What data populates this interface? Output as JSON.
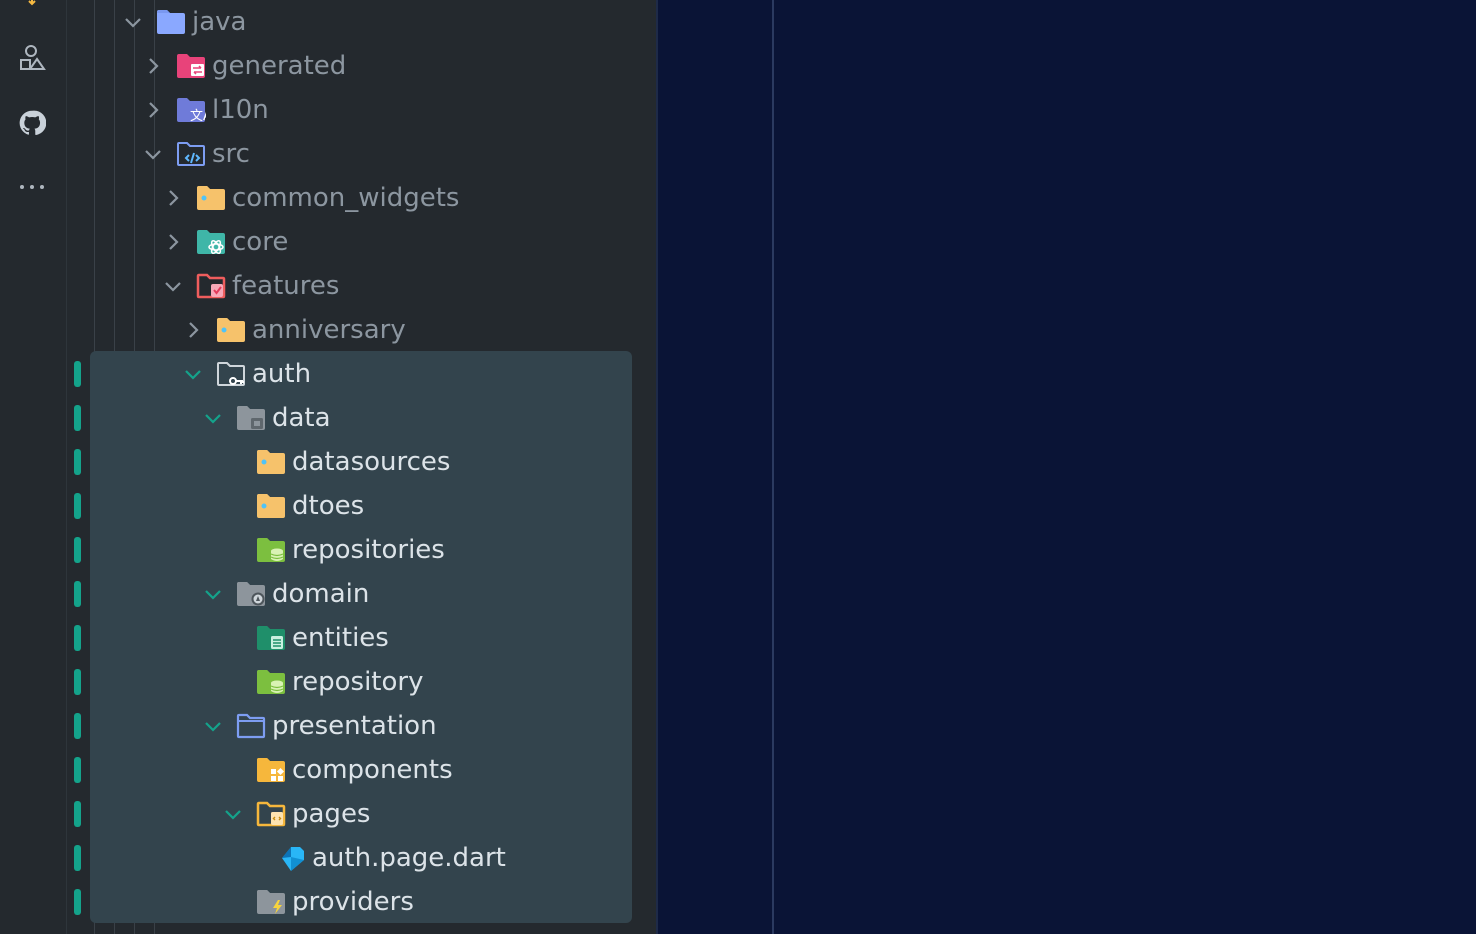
{
  "activity_bar": {
    "icons": [
      "extensions-shapes-icon",
      "github-icon",
      "more-icon"
    ]
  },
  "tree": {
    "items": [
      {
        "label": "java",
        "depth": 1,
        "expanded": true,
        "icon": "folder-java-icon"
      },
      {
        "label": "generated",
        "depth": 2,
        "expanded": false,
        "icon": "folder-generated-icon"
      },
      {
        "label": "l10n",
        "depth": 2,
        "expanded": false,
        "icon": "folder-l10n-icon"
      },
      {
        "label": "src",
        "depth": 2,
        "expanded": true,
        "icon": "folder-src-icon"
      },
      {
        "label": "common_widgets",
        "depth": 3,
        "expanded": false,
        "icon": "folder-icon"
      },
      {
        "label": "core",
        "depth": 3,
        "expanded": false,
        "icon": "folder-core-icon"
      },
      {
        "label": "features",
        "depth": 3,
        "expanded": true,
        "icon": "folder-features-icon"
      },
      {
        "label": "anniversary",
        "depth": 4,
        "expanded": false,
        "icon": "folder-icon"
      },
      {
        "label": "auth",
        "depth": 4,
        "expanded": true,
        "icon": "folder-auth-icon"
      },
      {
        "label": "data",
        "depth": 5,
        "expanded": true,
        "icon": "folder-data-icon"
      },
      {
        "label": "datasources",
        "depth": 6,
        "icon": "folder-icon"
      },
      {
        "label": "dtoes",
        "depth": 6,
        "icon": "folder-icon"
      },
      {
        "label": "repositories",
        "depth": 6,
        "icon": "folder-repository-icon"
      },
      {
        "label": "domain",
        "depth": 5,
        "expanded": true,
        "icon": "folder-domain-icon"
      },
      {
        "label": "entities",
        "depth": 6,
        "icon": "folder-entities-icon"
      },
      {
        "label": "repository",
        "depth": 6,
        "icon": "folder-repository-icon"
      },
      {
        "label": "presentation",
        "depth": 5,
        "expanded": true,
        "icon": "folder-presentation-icon"
      },
      {
        "label": "components",
        "depth": 6,
        "icon": "folder-components-icon"
      },
      {
        "label": "pages",
        "depth": 6,
        "expanded": true,
        "icon": "folder-pages-icon"
      },
      {
        "label": "auth.page.dart",
        "depth": 7,
        "icon": "dart-file-icon"
      },
      {
        "label": "providers",
        "depth": 6,
        "icon": "folder-providers-icon"
      }
    ]
  },
  "colors": {
    "sidebar_bg": "#24292e",
    "editor_bg": "#0a1436",
    "selection_bg": "#33444d",
    "git_marker": "#14a38b",
    "chevron_dim": "#8c96a0",
    "chevron_active": "#14a38b"
  }
}
